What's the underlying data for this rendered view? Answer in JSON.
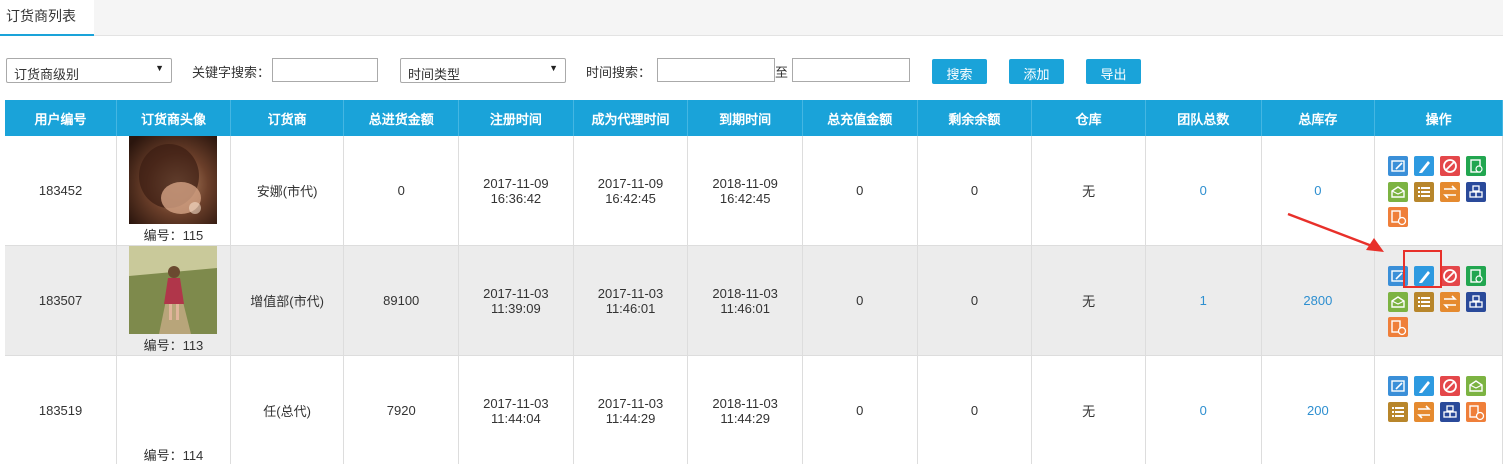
{
  "tab": {
    "label": "订货商列表"
  },
  "filters": {
    "level_select": "订货商级别",
    "keyword_label": "关键字搜索：",
    "keyword_value": "",
    "time_type_select": "时间类型",
    "time_label": "时间搜索：",
    "time_from": "",
    "to_label": "至",
    "time_to": "",
    "search_btn": "搜索",
    "add_btn": "添加",
    "export_btn": "导出"
  },
  "table": {
    "headers": [
      "用户编号",
      "订货商头像",
      "订货商",
      "总进货金额",
      "注册时间",
      "成为代理时间",
      "到期时间",
      "总充值金额",
      "剩余余额",
      "仓库",
      "团队总数",
      "总库存",
      "操作"
    ],
    "rows": [
      {
        "id": "183452",
        "avatar_no": "编号：115",
        "name": "安娜(市代)",
        "total_purchase": "0",
        "reg_date": "2017-11-09",
        "reg_time": "16:36:42",
        "agent_date": "2017-11-09",
        "agent_time": "16:42:45",
        "expire_date": "2018-11-09",
        "expire_time": "16:42:45",
        "total_recharge": "0",
        "balance": "0",
        "warehouse": "无",
        "team": "0",
        "stock": "0"
      },
      {
        "id": "183507",
        "avatar_no": "编号：113",
        "name": "增值部(市代)",
        "total_purchase": "89100",
        "reg_date": "2017-11-03",
        "reg_time": "11:39:09",
        "agent_date": "2017-11-03",
        "agent_time": "11:46:01",
        "expire_date": "2018-11-03",
        "expire_time": "11:46:01",
        "total_recharge": "0",
        "balance": "0",
        "warehouse": "无",
        "team": "1",
        "stock": "2800"
      },
      {
        "id": "183519",
        "avatar_no": "编号：114",
        "name": "任(总代)",
        "total_purchase": "7920",
        "reg_date": "2017-11-03",
        "reg_time": "11:44:04",
        "agent_date": "2017-11-03",
        "agent_time": "11:44:29",
        "expire_date": "2018-11-03",
        "expire_time": "11:44:29",
        "total_recharge": "0",
        "balance": "0",
        "warehouse": "无",
        "team": "0",
        "stock": "200"
      }
    ]
  },
  "colors": {
    "accent": "#1aa3d9",
    "link": "#2e8fd0",
    "highlight": "#e8302a"
  }
}
